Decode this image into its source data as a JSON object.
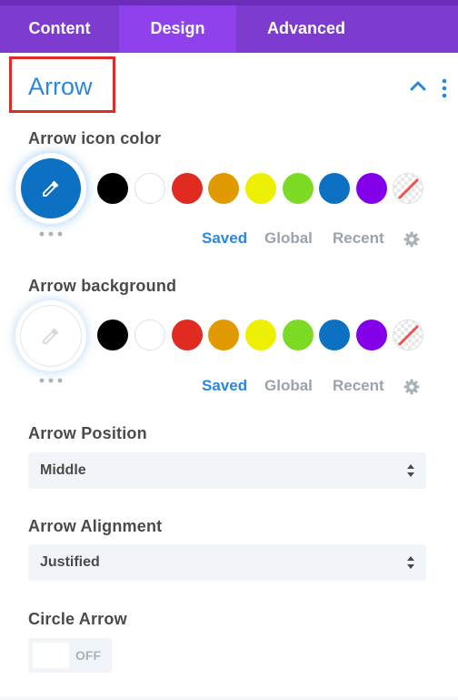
{
  "tabs": [
    {
      "label": "Content"
    },
    {
      "label": "Design",
      "active": true
    },
    {
      "label": "Advanced"
    }
  ],
  "section": {
    "title": "Arrow",
    "collapse_icon": "chevron-up-icon",
    "menu_icon": "kebab-menu-icon"
  },
  "icon_color": {
    "label": "Arrow icon color",
    "selected_color": "#0C71C3",
    "swatches": [
      "#000000",
      "#FFFFFF",
      "#E02B20",
      "#E09900",
      "#EDF000",
      "#7CDA24",
      "#0C71C3",
      "#8300E9",
      "none"
    ],
    "sub_tabs": [
      "Saved",
      "Global",
      "Recent"
    ],
    "active_sub_tab": "Saved"
  },
  "background": {
    "label": "Arrow background",
    "selected_color": "",
    "swatches": [
      "#000000",
      "#FFFFFF",
      "#E02B20",
      "#E09900",
      "#EDF000",
      "#7CDA24",
      "#0C71C3",
      "#8300E9",
      "none"
    ],
    "sub_tabs": [
      "Saved",
      "Global",
      "Recent"
    ],
    "active_sub_tab": "Saved"
  },
  "position": {
    "label": "Arrow Position",
    "value": "Middle"
  },
  "alignment": {
    "label": "Arrow Alignment",
    "value": "Justified"
  },
  "circle_arrow": {
    "label": "Circle Arrow",
    "state": "OFF"
  },
  "colors": {
    "tab_bar": "#7E3BD0",
    "tab_active": "#8F42EC",
    "accent": "#2B87DA",
    "highlight_box": "#E02B27"
  }
}
